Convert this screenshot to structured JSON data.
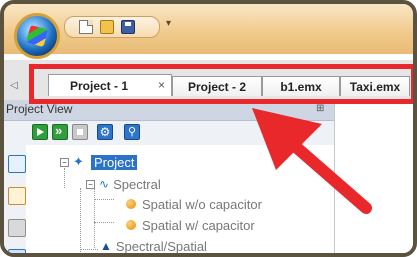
{
  "tabs": [
    {
      "label": "Project - 1",
      "active": true,
      "close_glyph": "×"
    },
    {
      "label": "Project - 2",
      "active": false
    },
    {
      "label": "b1.emx",
      "active": false
    },
    {
      "label": "Taxi.emx",
      "active": false
    }
  ],
  "panel": {
    "title": "Project View",
    "pin_glyph": "⊞"
  },
  "tree": {
    "root": "Project",
    "items": [
      {
        "label": "Spectral",
        "children": [
          "Spatial w/o capacitor",
          "Spatial w/ capacitor"
        ]
      },
      {
        "label": "Spectral/Spatial"
      }
    ]
  },
  "qat_menu_glyph": "▾",
  "scroll_glyph": "◁",
  "icons": {
    "app": "app-orb-icon",
    "new": "new-file-icon",
    "open": "open-folder-icon",
    "save": "save-icon",
    "run": "play-icon",
    "run_all": "fast-forward-icon",
    "stop": "stop-icon",
    "settings": "gear-icon",
    "search": "search-icon"
  },
  "colors": {
    "accent": "#2a73c7",
    "highlight": "#e8282b",
    "ribbon": "#f0c98a",
    "frame": "#5b5340"
  }
}
